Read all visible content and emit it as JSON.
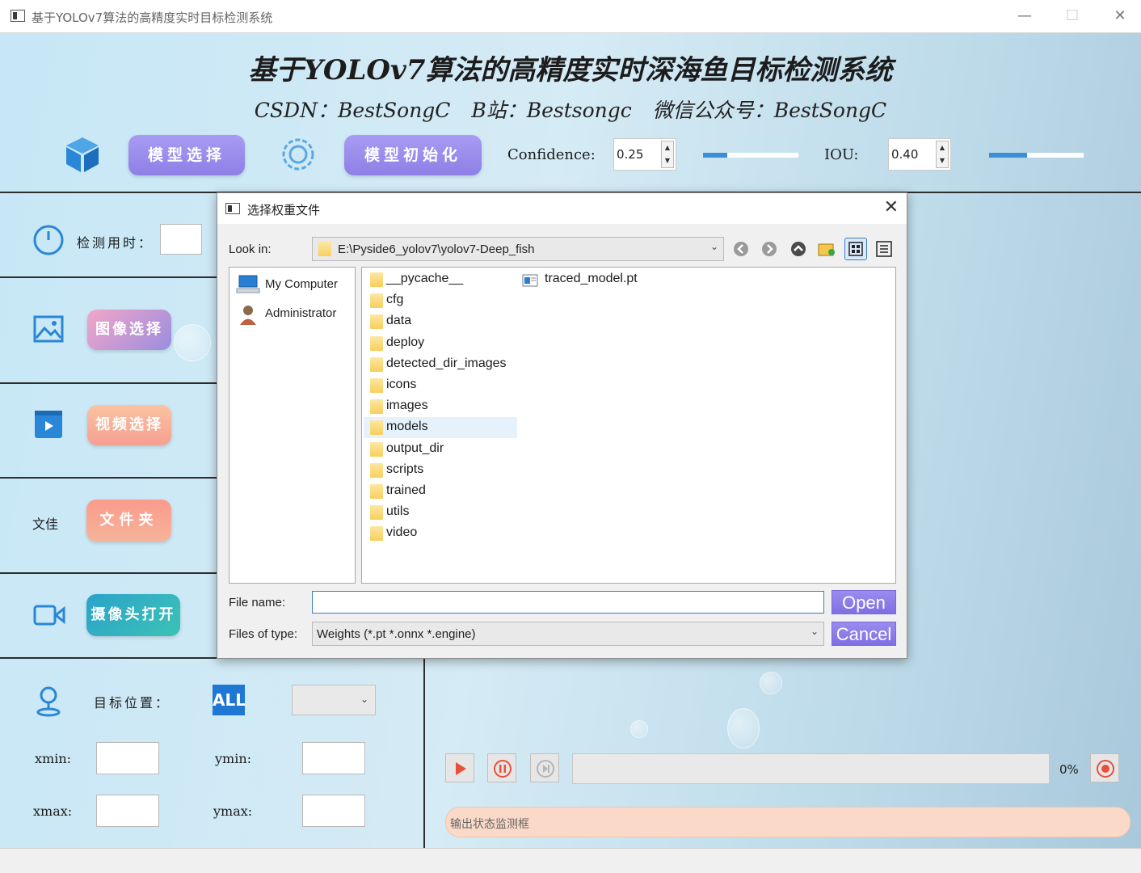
{
  "window": {
    "title": "基于YOLOv7算法的高精度实时目标检测系统",
    "min": "—",
    "max": "☐",
    "close": "✕"
  },
  "header": {
    "title": "基于YOLOv7算法的高精度实时深海鱼目标检测系统",
    "subtitle": "CSDN：BestSongC  B站：Bestsongc  微信公众号：BestSongC"
  },
  "toolbar": {
    "model_select": "模型选择",
    "model_init": "模型初始化",
    "confidence_label": "Confidence:",
    "confidence_value": "0.25",
    "confidence_level": 0.25,
    "iou_label": "IOU:",
    "iou_value": "0.40",
    "iou_level": 0.4
  },
  "side": {
    "detect_time_label": "检测用时：",
    "image_select": "图像选择",
    "video_select": "视频选择",
    "file_label": "文佳",
    "folder": "文件夹",
    "camera_open": "摄像头打开",
    "target_position_label": "目标位置：",
    "all_badge": "ALL",
    "xmin_label": "xmin:",
    "ymin_label": "ymin:",
    "xmax_label": "xmax:",
    "ymax_label": "ymax:"
  },
  "player": {
    "progress_text": "0%",
    "progress": 0,
    "status_text": "输出状态监测框"
  },
  "dialog": {
    "title": "选择权重文件",
    "close": "✕",
    "look_in_label": "Look in:",
    "look_in_path": "E:\\Pyside6_yolov7\\yolov7-Deep_fish",
    "sidebar": [
      "My Computer",
      "Administrator"
    ],
    "folders": [
      "__pycache__",
      "cfg",
      "data",
      "deploy",
      "detected_dir_images",
      "icons",
      "images",
      "models",
      "output_dir",
      "scripts",
      "trained",
      "utils",
      "video"
    ],
    "selected_folder": "models",
    "file": "traced_model.pt",
    "file_name_label": "File name:",
    "file_name_value": "",
    "files_of_type_label": "Files of type:",
    "files_of_type_value": "Weights (*.pt *.onnx *.engine)",
    "open_button": "Open",
    "cancel_button": "Cancel"
  },
  "colors": {
    "accent_purple": "#8e7fe6",
    "slider_fill": "#3a8fd6",
    "status_peach": "#fbd9c9",
    "icon_blue": "#2a86d6"
  }
}
